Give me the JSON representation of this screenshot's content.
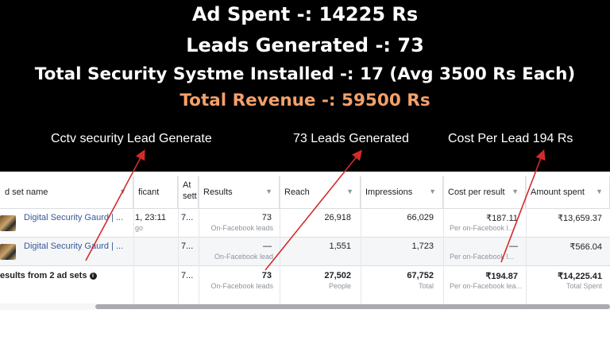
{
  "banner": {
    "line1": "Ad Spent -: 14225 Rs",
    "line2": "Leads Generated -: 73",
    "line3": "Total Security Systme Installed -: 17 (Avg 3500 Rs Each)",
    "line4": "Total Revenue -: 59500 Rs",
    "highlight_color": "#f4a06a"
  },
  "captions": {
    "left": "Cctv security Lead Generate",
    "middle": "73 Leads Generated",
    "right": "Cost Per Lead 194 Rs"
  },
  "table": {
    "headers": {
      "name": "d set name",
      "significant": "ficant",
      "attribution_top": "At",
      "attribution_bottom": "sett",
      "results": "Results",
      "reach": "Reach",
      "impressions": "Impressions",
      "cost_per_result": "Cost per result",
      "amount_spent": "Amount spent"
    },
    "rows": [
      {
        "name": "Digital Security Gaurd | ...",
        "significant": "1, 23:11",
        "significant_sub": "go",
        "attribution": "7...",
        "results": "73",
        "results_sub": "On-Facebook leads",
        "reach": "26,918",
        "impressions": "66,029",
        "cost_per_result": "₹187.11",
        "cost_sub": "Per on-Facebook l...",
        "amount_spent": "₹13,659.37"
      },
      {
        "name": "Digital Security Gaurd | ...",
        "significant": "",
        "significant_sub": "",
        "attribution": "7...",
        "results": "—",
        "results_sub": "On-Facebook lead",
        "reach": "1,551",
        "impressions": "1,723",
        "cost_per_result": "—",
        "cost_sub": "Per on-Facebook l...",
        "amount_spent": "₹566.04"
      }
    ],
    "summary": {
      "name": "esults from 2 ad sets",
      "attribution": "7...",
      "results": "73",
      "results_sub": "On-Facebook leads",
      "reach": "27,502",
      "reach_sub": "People",
      "impressions": "67,752",
      "impressions_sub": "Total",
      "cost_per_result": "₹194.87",
      "cost_sub": "Per on-Facebook lea...",
      "amount_spent": "₹14,225.41",
      "amount_sub": "Total Spent"
    }
  },
  "colors": {
    "arrow": "#d42a2a",
    "link": "#385898"
  }
}
